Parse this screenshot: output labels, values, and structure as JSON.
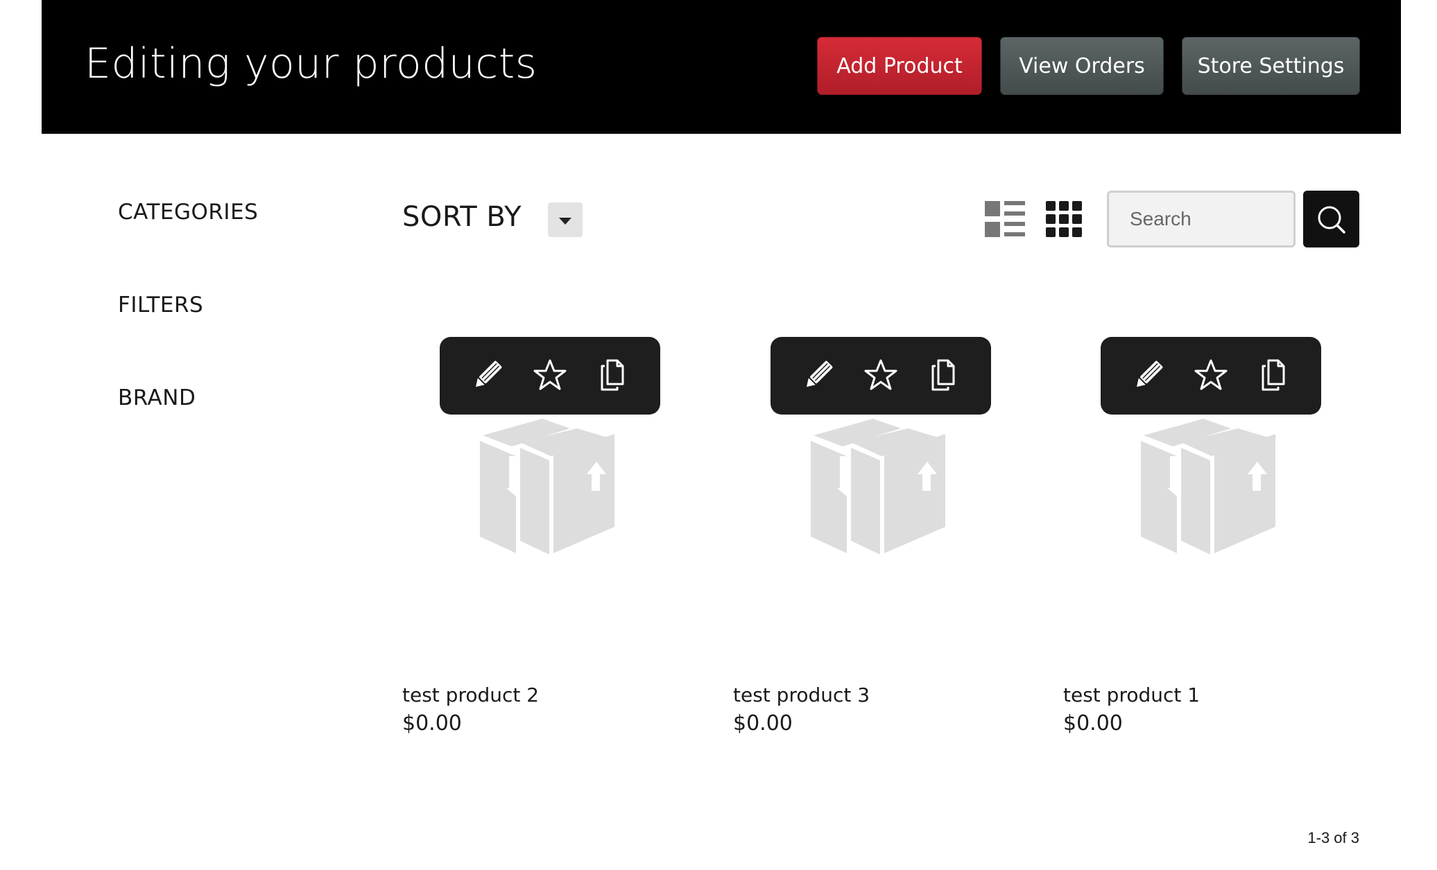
{
  "header": {
    "title": "Editing your products",
    "buttons": {
      "add_product": "Add Product",
      "view_orders": "View Orders",
      "store_settings": "Store Settings"
    },
    "colors": {
      "background": "#000000",
      "add_button": "#c9232f",
      "secondary_button": "#4f5859"
    }
  },
  "sidebar": {
    "items": [
      {
        "label": "CATEGORIES"
      },
      {
        "label": "FILTERS"
      },
      {
        "label": "BRAND"
      }
    ]
  },
  "toolbar": {
    "sort_label": "SORT BY",
    "sort_icon": "caret-down-icon",
    "view_modes": [
      "list-view-icon",
      "grid-view-icon"
    ],
    "search": {
      "placeholder": "Search",
      "value": ""
    },
    "search_icon": "magnifier-icon"
  },
  "products": [
    {
      "name": "test product 2",
      "price": "$0.00"
    },
    {
      "name": "test product 3",
      "price": "$0.00"
    },
    {
      "name": "test product 1",
      "price": "$0.00"
    }
  ],
  "product_actions": [
    "pencil-icon",
    "star-icon",
    "copy-icon"
  ],
  "product_image_icon": "box-placeholder-icon",
  "pagination": {
    "text": "1-3 of 3"
  }
}
